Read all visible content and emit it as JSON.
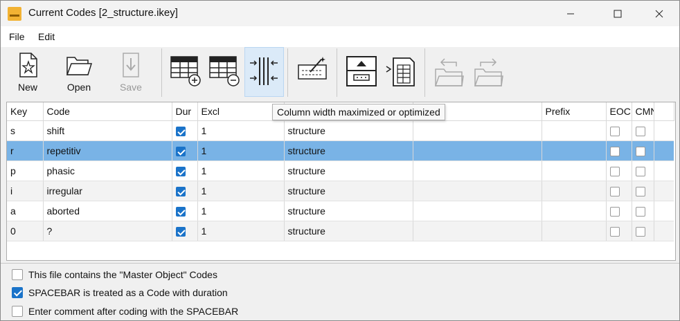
{
  "window": {
    "title": "Current Codes [2_structure.ikey]",
    "minimize_icon": "minimize-icon",
    "maximize_icon": "maximize-icon",
    "close_icon": "close-icon"
  },
  "menu": {
    "file": "File",
    "edit": "Edit"
  },
  "toolbar": {
    "new_label": "New",
    "open_label": "Open",
    "save_label": "Save",
    "add_column_icon": "table-add-icon",
    "remove_column_icon": "table-remove-icon",
    "column_width_icon": "column-width-icon",
    "wand_icon": "magic-wand-icon",
    "device_icon": "device-icon",
    "list_icon": "list-icon",
    "undo_icon": "folder-undo-icon",
    "redo_icon": "folder-redo-icon"
  },
  "tooltip": "Column width maximized or optimized",
  "grid": {
    "headers": [
      "Key",
      "Code",
      "Dur",
      "Excl",
      "",
      "",
      "Prefix",
      "EOC",
      "CMN"
    ],
    "rows": [
      {
        "key": "s",
        "code": "shift",
        "dur": true,
        "excl": "1",
        "class": "structure",
        "eoc": false,
        "cmn": false
      },
      {
        "key": "r",
        "code": "repetitiv",
        "dur": true,
        "excl": "1",
        "class": "structure",
        "eoc": false,
        "cmn": false
      },
      {
        "key": "p",
        "code": "phasic",
        "dur": true,
        "excl": "1",
        "class": "structure",
        "eoc": false,
        "cmn": false
      },
      {
        "key": "i",
        "code": "irregular",
        "dur": true,
        "excl": "1",
        "class": "structure",
        "eoc": false,
        "cmn": false
      },
      {
        "key": "a",
        "code": "aborted",
        "dur": true,
        "excl": "1",
        "class": "structure",
        "eoc": false,
        "cmn": false
      },
      {
        "key": "0",
        "code": "?",
        "dur": true,
        "excl": "1",
        "class": "structure",
        "eoc": false,
        "cmn": false
      }
    ],
    "selected_row": 1
  },
  "options": {
    "master_object": {
      "label": "This file contains the \"Master Object\" Codes",
      "checked": false
    },
    "spacebar_duration": {
      "label": "SPACEBAR is treated as a Code with duration",
      "checked": true
    },
    "comment_after": {
      "label": "Enter comment after coding with the SPACEBAR",
      "checked": false
    }
  },
  "colors": {
    "selection": "#79b3e6",
    "checkbox": "#1a73c9",
    "icon_bg": "#f2b233"
  }
}
